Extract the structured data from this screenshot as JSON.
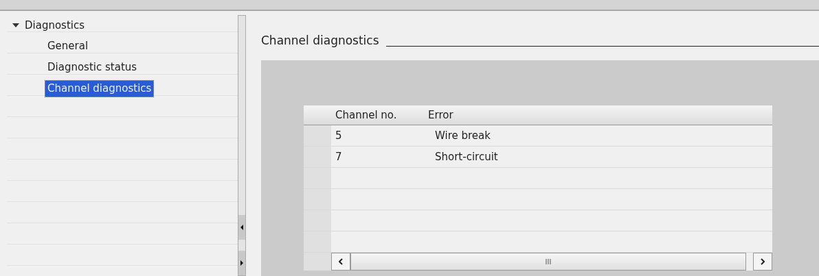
{
  "tree": {
    "label": "Diagnostics",
    "expanded": true,
    "children": [
      {
        "label": "General",
        "selected": false
      },
      {
        "label": "Diagnostic status",
        "selected": false
      },
      {
        "label": "Channel diagnostics",
        "selected": true
      }
    ]
  },
  "section": {
    "title": "Channel diagnostics"
  },
  "table": {
    "columns": [
      "Channel no.",
      "Error"
    ],
    "rows": [
      {
        "channel": "5",
        "error": "Wire break"
      },
      {
        "channel": "7",
        "error": "Short-circuit"
      }
    ]
  },
  "scrollbar": {
    "thumb_grip": "III"
  }
}
